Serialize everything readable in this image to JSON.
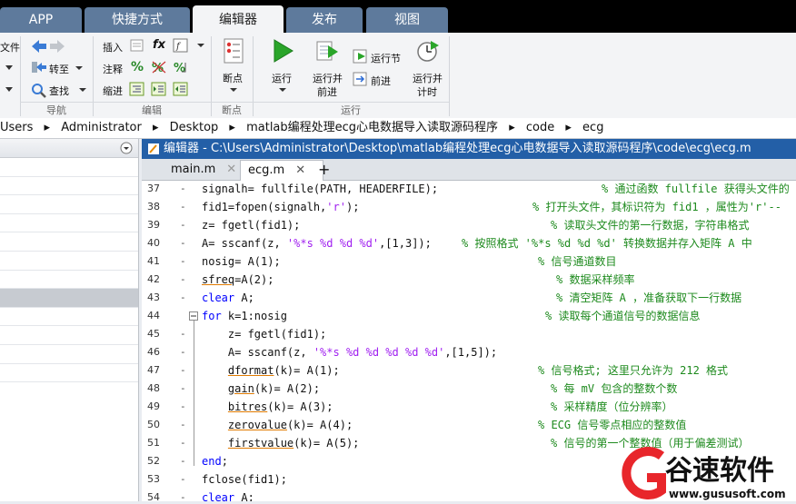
{
  "tabs": [
    "APP",
    "快捷方式",
    "编辑器",
    "发布",
    "视图"
  ],
  "ribbon": {
    "file_partial": "文件",
    "nav": {
      "forward": "转至",
      "find": "查找",
      "group": "导航"
    },
    "edit": {
      "insert": "插入",
      "fx": "fx",
      "comment": "注释",
      "percent": "%",
      "indent": "缩进",
      "group": "编辑"
    },
    "breakpoints": {
      "label": "断点",
      "group": "断点"
    },
    "run": {
      "run": "运行",
      "run_advance_1": "运行并",
      "run_advance_2": "前进",
      "run_section": "运行节",
      "advance": "前进",
      "run_time_1": "运行并",
      "run_time_2": "计时",
      "group": "运行"
    }
  },
  "breadcrumb": [
    "Users",
    "Administrator",
    "Desktop",
    "matlab编程处理ecg心电数据导入读取源码程序",
    "code",
    "ecg"
  ],
  "editor": {
    "title": "编辑器 - C:\\Users\\Administrator\\Desktop\\matlab编程处理ecg心电数据导入读取源码程序\\code\\ecg\\ecg.m",
    "file_tabs": [
      "main.m",
      "ecg.m"
    ],
    "add_tab": "+",
    "lines": [
      {
        "n": "37",
        "code": "signalh= fullfile(PATH, HEADERFILE);",
        "comment": "% 通过函数 fullfile 获得头文件的"
      },
      {
        "n": "38",
        "code": "fid1=fopen(signalh,'r');",
        "comment": "% 打开头文件，其标识符为 fid1 ，属性为'r'--"
      },
      {
        "n": "39",
        "code": "z= fgetl(fid1);",
        "comment": "% 读取头文件的第一行数据，字符串格式"
      },
      {
        "n": "40",
        "code": "A= sscanf(z, '%*s %d %d %d',[1,3]);",
        "comment": "% 按照格式 '%*s %d %d %d' 转换数据并存入矩阵 A 中"
      },
      {
        "n": "41",
        "code": "nosig= A(1);",
        "comment": "% 信号通道数目"
      },
      {
        "n": "42",
        "code": "sfreq=A(2);",
        "comment": "% 数据采样频率"
      },
      {
        "n": "43",
        "code": "clear A;",
        "comment": "% 清空矩阵 A ，准备获取下一行数据"
      },
      {
        "n": "44",
        "code": "for k=1:nosig",
        "comment": "% 读取每个通道信号的数据信息"
      },
      {
        "n": "45",
        "code": "    z= fgetl(fid1);",
        "comment": ""
      },
      {
        "n": "46",
        "code": "    A= sscanf(z, '%*s %d %d %d %d %d',[1,5]);",
        "comment": ""
      },
      {
        "n": "47",
        "code": "    dformat(k)= A(1);",
        "comment": "% 信号格式; 这里只允许为 212 格式"
      },
      {
        "n": "48",
        "code": "    gain(k)= A(2);",
        "comment": "% 每 mV 包含的整数个数"
      },
      {
        "n": "49",
        "code": "    bitres(k)= A(3);",
        "comment": "% 采样精度（位分辨率）"
      },
      {
        "n": "50",
        "code": "    zerovalue(k)= A(4);",
        "comment": "% ECG 信号零点相应的整数值"
      },
      {
        "n": "51",
        "code": "    firstvalue(k)= A(5);",
        "comment": "% 信号的第一个整数值（用于偏差测试）"
      },
      {
        "n": "52",
        "code": "end;",
        "comment": ""
      },
      {
        "n": "53",
        "code": "fclose(fid1);",
        "comment": ""
      },
      {
        "n": "54",
        "code": "clear A;",
        "comment": ""
      }
    ]
  },
  "watermark": {
    "name": "谷速软件",
    "url": "www.gususoft.com"
  },
  "colors": {
    "title_bar": "#235fa7",
    "comment": "#1d8a1d",
    "keyword": "#0000ff",
    "string": "#a020f0",
    "tab_inactive": "#5e7a9c",
    "watermark_red": "#e8262b"
  }
}
